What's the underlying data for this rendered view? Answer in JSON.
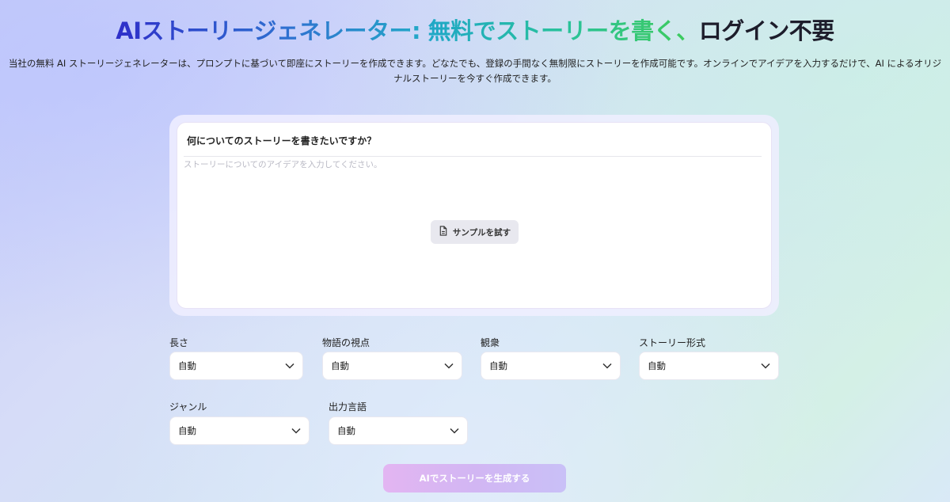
{
  "header": {
    "title_part1": "AIストーリージェネレーター:",
    "title_part2": "無料でストーリーを書く、",
    "title_part3": "ログイン不要",
    "description": "当社の無料 AI ストーリージェネレーターは、プロンプトに基づいて即座にストーリーを作成できます。どなたでも、登録の手間なく無制限にストーリーを作成可能です。オンラインでアイデアを入力するだけで、AI によるオリジナルストーリーを今すぐ作成できます。"
  },
  "prompt_card": {
    "question": "何についてのストーリーを書きたいですか？",
    "input_value": "",
    "input_placeholder": "ストーリーについてのアイデアを入力してください。",
    "sample_button": "サンプルを試す",
    "sample_icon": "document-icon"
  },
  "options": [
    {
      "label": "長さ",
      "value": "自動"
    },
    {
      "label": "物語の視点",
      "value": "自動"
    },
    {
      "label": "観衆",
      "value": "自動"
    },
    {
      "label": "ストーリー形式",
      "value": "自動"
    },
    {
      "label": "ジャンル",
      "value": "自動"
    },
    {
      "label": "出力言語",
      "value": "自動"
    }
  ],
  "generate_button": "AIでストーリーを生成する",
  "colors": {
    "accent_gradient_start": "#e3b5f2",
    "accent_gradient_end": "#c9c0f7",
    "title_blue": "#2f2fc9",
    "title_green": "#3fcc57"
  }
}
